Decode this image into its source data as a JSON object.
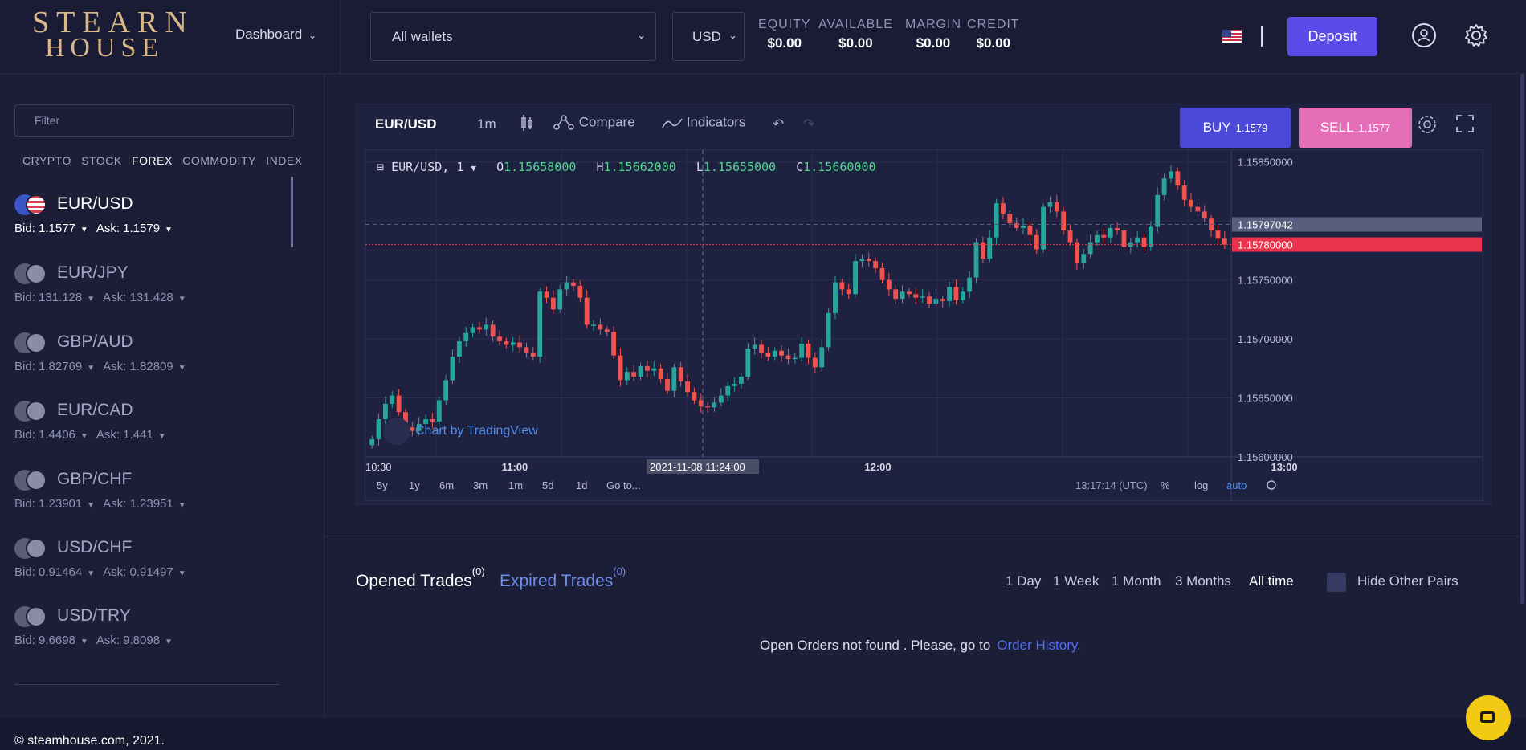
{
  "header": {
    "logo_line1": "STEARN",
    "logo_line2": "HOUSE",
    "dashboard_label": "Dashboard",
    "wallet_select": "All wallets",
    "currency_select": "USD",
    "stats": [
      {
        "label": "EQUITY",
        "value": "$0.00"
      },
      {
        "label": "AVAILABLE",
        "value": "$0.00"
      },
      {
        "label": "MARGIN",
        "value": "$0.00"
      },
      {
        "label": "CREDIT",
        "value": "$0.00"
      }
    ],
    "deposit_label": "Deposit",
    "icons": [
      "us-flag-icon",
      "user-icon",
      "gear-icon"
    ]
  },
  "sidebar": {
    "filter_placeholder": "Filter",
    "categories": [
      "CRYPTO",
      "STOCK",
      "FOREX",
      "COMMODITY",
      "INDEX"
    ],
    "active_category": "FOREX",
    "pairs": [
      {
        "name": "EUR/USD",
        "bid": "Bid: 1.1577",
        "ask": "Ask: 1.1579"
      },
      {
        "name": "EUR/JPY",
        "bid": "Bid: 131.128",
        "ask": "Ask: 131.428"
      },
      {
        "name": "GBP/AUD",
        "bid": "Bid: 1.82769",
        "ask": "Ask: 1.82809"
      },
      {
        "name": "EUR/CAD",
        "bid": "Bid: 1.4406",
        "ask": "Ask: 1.441"
      },
      {
        "name": "GBP/CHF",
        "bid": "Bid: 1.23901",
        "ask": "Ask: 1.23951"
      },
      {
        "name": "USD/CHF",
        "bid": "Bid: 0.91464",
        "ask": "Ask: 0.91497"
      },
      {
        "name": "USD/TRY",
        "bid": "Bid: 9.6698",
        "ask": "Ask: 9.8098"
      }
    ]
  },
  "chart_toolbar": {
    "symbol": "EUR/USD",
    "interval": "1m",
    "compare": "Compare",
    "indicators": "Indicators",
    "buy_label": "BUY",
    "buy_price": "1.1579",
    "sell_label": "SELL",
    "sell_price": "1.1577"
  },
  "chart_data": {
    "type": "candlestick",
    "legend_symbol": "EUR/USD, 1",
    "ohlc": {
      "O": "1.15658000",
      "H": "1.15662000",
      "L": "1.15655000",
      "C": "1.15660000"
    },
    "price_axis": [
      "1.15850000",
      "1.15750000",
      "1.15700000",
      "1.15650000",
      "1.15600000"
    ],
    "price_markers": [
      {
        "value": "1.15797042",
        "color": "#5a5e7e"
      },
      {
        "value": "1.15780000",
        "color": "#e8334a"
      }
    ],
    "time_axis": [
      "10:30",
      "11:00",
      "12:00",
      "13:00"
    ],
    "cursor_time": "2021-11-08 11:24:00",
    "ylim": [
      1.156,
      1.1586
    ],
    "colors": {
      "up": "#26a69a",
      "down": "#ef5350"
    },
    "closes": [
      1.15615,
      1.15632,
      1.15645,
      1.15652,
      1.15638,
      1.15625,
      1.15622,
      1.15628,
      1.15632,
      1.1563,
      1.15648,
      1.15665,
      1.15685,
      1.15698,
      1.15705,
      1.1571,
      1.15708,
      1.15712,
      1.15702,
      1.15698,
      1.15695,
      1.15697,
      1.15693,
      1.15688,
      1.15685,
      1.1574,
      1.15735,
      1.15725,
      1.15742,
      1.15748,
      1.15745,
      1.15735,
      1.15712,
      1.15712,
      1.15708,
      1.15706,
      1.15686,
      1.15665,
      1.15672,
      1.15668,
      1.15677,
      1.15673,
      1.15675,
      1.15666,
      1.15656,
      1.15676,
      1.15664,
      1.15655,
      1.15648,
      1.15643,
      1.15642,
      1.15646,
      1.15652,
      1.1566,
      1.15662,
      1.15668,
      1.15692,
      1.15695,
      1.15688,
      1.15685,
      1.1569,
      1.15686,
      1.15683,
      1.15684,
      1.15696,
      1.15684,
      1.15676,
      1.15693,
      1.15722,
      1.15748,
      1.15742,
      1.15738,
      1.15766,
      1.15768,
      1.15766,
      1.1576,
      1.1575,
      1.15742,
      1.15734,
      1.1574,
      1.15738,
      1.15735,
      1.15736,
      1.1573,
      1.15734,
      1.15732,
      1.15744,
      1.15733,
      1.1574,
      1.15752,
      1.15782,
      1.15768,
      1.15786,
      1.15815,
      1.15806,
      1.15798,
      1.15794,
      1.15796,
      1.15788,
      1.15776,
      1.15812,
      1.15816,
      1.15808,
      1.15792,
      1.15782,
      1.15764,
      1.15772,
      1.15782,
      1.15788,
      1.15786,
      1.15794,
      1.15792,
      1.15778,
      1.15782,
      1.15786,
      1.15778,
      1.15795,
      1.15822,
      1.15836,
      1.15842,
      1.1583,
      1.15818,
      1.15812,
      1.15808,
      1.15802,
      1.15792,
      1.15785,
      1.1578
    ]
  },
  "chart_bottom": {
    "ranges": [
      "5y",
      "1y",
      "6m",
      "3m",
      "1m",
      "5d",
      "1d",
      "Go to..."
    ],
    "clock": "13:17:14 (UTC)",
    "options": [
      "%",
      "log",
      "auto"
    ]
  },
  "watermark": "Chart by TradingView",
  "trades": {
    "opened_label": "Opened Trades",
    "opened_count": "(0)",
    "expired_label": "Expired Trades",
    "expired_count": "(0)",
    "ranges": [
      "1 Day",
      "1 Week",
      "1 Month",
      "3 Months",
      "All time"
    ],
    "active_range": "All time",
    "hide_label": "Hide Other Pairs",
    "empty_message": "Open Orders not found . Please, go to",
    "history_link": "Order History."
  },
  "footer": {
    "copyright": "© steamhouse.com, 2021."
  }
}
